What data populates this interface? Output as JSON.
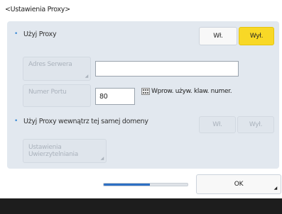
{
  "screen": {
    "title": "<Ustawienia Proxy>"
  },
  "use_proxy": {
    "label": "Użyj Proxy",
    "on_label": "Wł.",
    "off_label": "Wył.",
    "selected": "off"
  },
  "server_address": {
    "button_label": "Adres Serwera",
    "value": ""
  },
  "port_number": {
    "button_label": "Numer Portu",
    "value": "80",
    "hint": "Wprow. używ. klaw. numer."
  },
  "use_proxy_same_domain": {
    "label": "Użyj Proxy wewnątrz tej samej domeny",
    "on_label": "Wł.",
    "off_label": "Wył."
  },
  "auth_settings": {
    "label_line1": "Ustawienia",
    "label_line2": "Uwierzytelniania"
  },
  "progress": {
    "fraction": 0.55
  },
  "ok_button": {
    "label": "OK"
  },
  "colors": {
    "selected": "#f8d826",
    "panel": "#e2e8ef",
    "bullet": "#3d8bd6",
    "progress": "#2d6fc4"
  }
}
